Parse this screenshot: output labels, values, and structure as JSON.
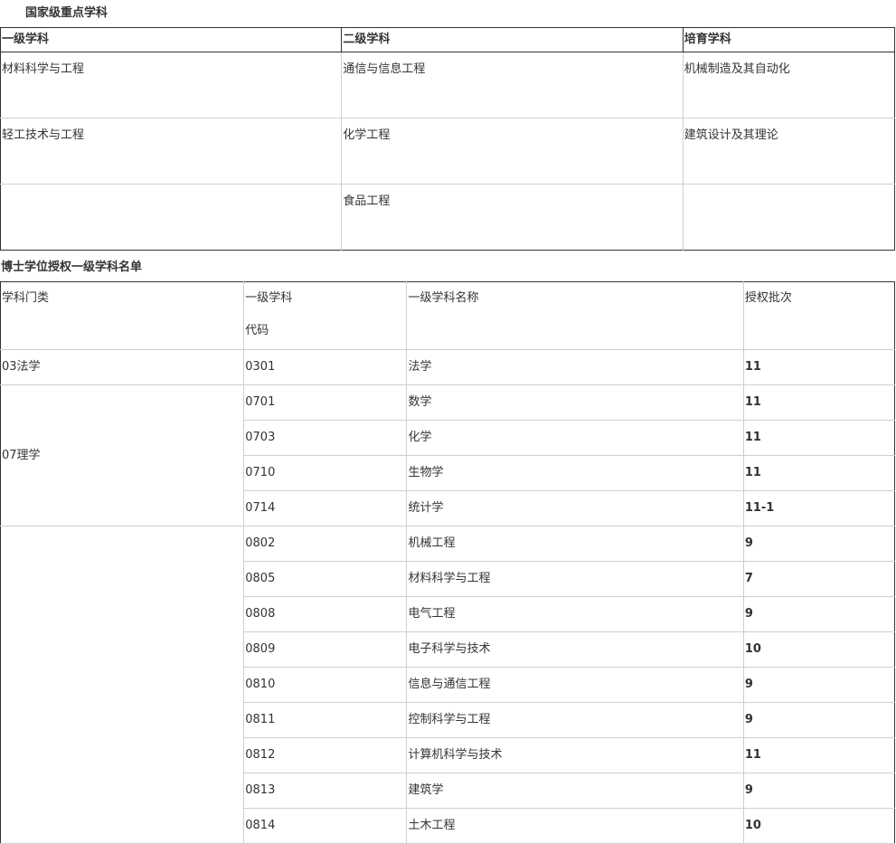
{
  "section1": {
    "title": "国家级重点学科",
    "headers": [
      "一级学科",
      "二级学科",
      "培育学科"
    ],
    "rows": [
      [
        "材料科学与工程",
        "通信与信息工程",
        "机械制造及其自动化"
      ],
      [
        "轻工技术与工程",
        "化学工程",
        "建筑设计及其理论"
      ],
      [
        "",
        "食品工程",
        ""
      ]
    ]
  },
  "section2": {
    "title": "博士学位授权一级学科名单",
    "headers": {
      "category": "学科门类",
      "code_line1": "一级学科",
      "code_line2": "代码",
      "name": "一级学科名称",
      "batch": "授权批次"
    },
    "groups": [
      {
        "category": "03法学",
        "rows": [
          {
            "code": "0301",
            "name": "法学",
            "batch": "11"
          }
        ]
      },
      {
        "category": "07理学",
        "rows": [
          {
            "code": "0701",
            "name": "数学",
            "batch": "11"
          },
          {
            "code": "0703",
            "name": "化学",
            "batch": "11"
          },
          {
            "code": "0710",
            "name": "生物学",
            "batch": "11"
          },
          {
            "code": "0714",
            "name": "统计学",
            "batch": "11-1"
          }
        ]
      },
      {
        "category": "",
        "rows": [
          {
            "code": "0802",
            "name": "机械工程",
            "batch": "9"
          },
          {
            "code": "0805",
            "name": "材料科学与工程",
            "batch": "7"
          },
          {
            "code": "0808",
            "name": "电气工程",
            "batch": "9"
          },
          {
            "code": "0809",
            "name": "电子科学与技术",
            "batch": "10"
          },
          {
            "code": "0810",
            "name": "信息与通信工程",
            "batch": "9"
          },
          {
            "code": "0811",
            "name": "控制科学与工程",
            "batch": "9"
          },
          {
            "code": "0812",
            "name": "计算机科学与技术",
            "batch": "11"
          },
          {
            "code": "0813",
            "name": "建筑学",
            "batch": "9"
          },
          {
            "code": "0814",
            "name": "土木工程",
            "batch": "10"
          }
        ]
      }
    ]
  }
}
